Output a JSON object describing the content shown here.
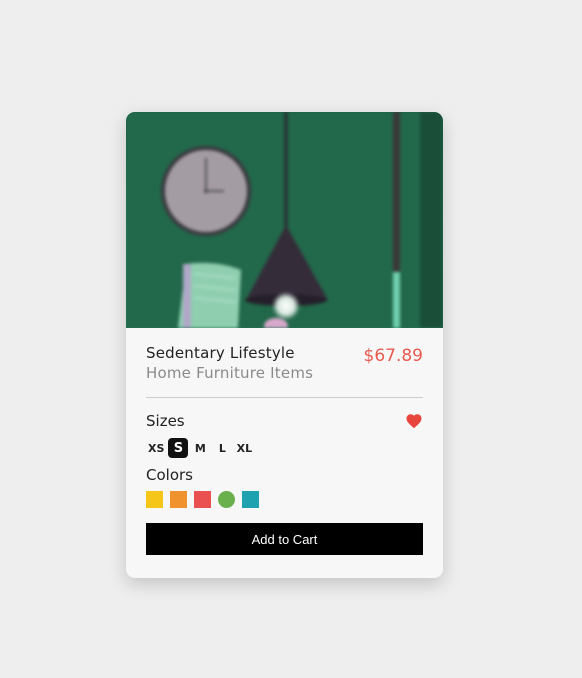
{
  "product": {
    "name": "Sedentary Lifestyle",
    "category": "Home Furniture Items",
    "price": "$67.89"
  },
  "sizes": {
    "label": "Sizes",
    "options": [
      "XS",
      "S",
      "M",
      "L",
      "XL"
    ],
    "selected": "S"
  },
  "colors": {
    "label": "Colors",
    "options": [
      {
        "name": "yellow",
        "hex": "#f5c518",
        "shape": "square"
      },
      {
        "name": "orange",
        "hex": "#f0922e",
        "shape": "square"
      },
      {
        "name": "red",
        "hex": "#ea5050",
        "shape": "square"
      },
      {
        "name": "green",
        "hex": "#6ab04c",
        "shape": "circle"
      },
      {
        "name": "teal",
        "hex": "#1fa2b0",
        "shape": "square"
      }
    ]
  },
  "favorite": {
    "icon": "heart-icon",
    "color": "#e8453c"
  },
  "cart": {
    "label": "Add to Cart"
  },
  "theme": {
    "accent": "#e85a50",
    "button": "#000000"
  }
}
